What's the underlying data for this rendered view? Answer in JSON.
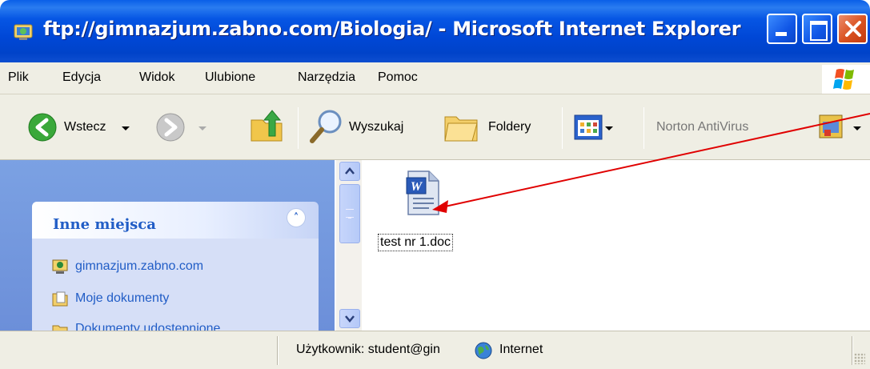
{
  "window": {
    "title": "ftp://gimnazjum.zabno.com/Biologia/ - Microsoft Internet Explorer"
  },
  "menu": {
    "items": [
      "Plik",
      "Edycja",
      "Widok",
      "Ulubione",
      "Narzędzia",
      "Pomoc"
    ]
  },
  "toolbar": {
    "back_label": "Wstecz",
    "search_label": "Wyszukaj",
    "folders_label": "Foldery",
    "norton_label": "Norton AntiVirus"
  },
  "sidebar": {
    "section_title": "Inne miejsca",
    "links": [
      "gimnazjum.zabno.com",
      "Moje dokumenty",
      "Dokumenty udostępnione"
    ]
  },
  "files": [
    {
      "name": "test nr 1.doc",
      "icon": "word-document-icon"
    }
  ],
  "status": {
    "user": "Użytkownik: student@gin",
    "zone": "Internet"
  },
  "colors": {
    "titlebar": "#0047d6",
    "sidebar_bg": "#7ba1e3",
    "link": "#215dc6",
    "annotation_arrow": "#e00000"
  }
}
